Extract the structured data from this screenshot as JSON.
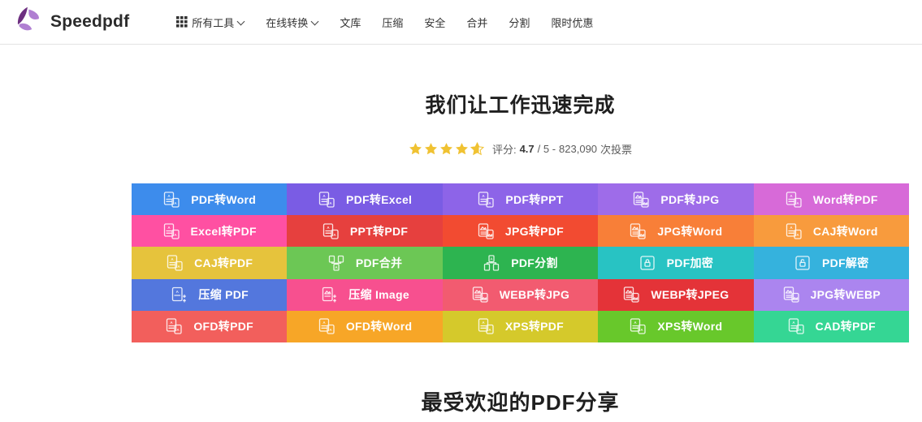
{
  "brand": {
    "name": "Speedpdf"
  },
  "nav": {
    "items": [
      {
        "label": "所有工具",
        "grid_icon": true,
        "chevron": true
      },
      {
        "label": "在线转换",
        "grid_icon": false,
        "chevron": true
      },
      {
        "label": "文库",
        "grid_icon": false,
        "chevron": false
      },
      {
        "label": "压缩",
        "grid_icon": false,
        "chevron": false
      },
      {
        "label": "安全",
        "grid_icon": false,
        "chevron": false
      },
      {
        "label": "合并",
        "grid_icon": false,
        "chevron": false
      },
      {
        "label": "分割",
        "grid_icon": false,
        "chevron": false
      },
      {
        "label": "限时优惠",
        "grid_icon": false,
        "chevron": false
      }
    ]
  },
  "hero": {
    "title": "我们让工作迅速完成",
    "rating": {
      "stars_full": 4,
      "partial_fill_percent": 65,
      "star_color": "#f0c232",
      "prefix": "评分:",
      "score": "4.7",
      "mid": "/ 5 -",
      "votes": "823,090",
      "suffix": "次投票"
    }
  },
  "tools": {
    "cells": [
      {
        "label": "PDF转Word",
        "color": "#3d8cec",
        "icon": "docs-convert-icon"
      },
      {
        "label": "PDF转Excel",
        "color": "#7a5ce4",
        "icon": "docs-convert-icon"
      },
      {
        "label": "PDF转PPT",
        "color": "#8d64e8",
        "icon": "docs-convert-icon"
      },
      {
        "label": "PDF转JPG",
        "color": "#9e6ce9",
        "icon": "docs-image-convert-icon"
      },
      {
        "label": "Word转PDF",
        "color": "#d76ad8",
        "icon": "docs-convert-icon"
      },
      {
        "label": "Excel转PDF",
        "color": "#ff50a2",
        "icon": "docs-convert-icon"
      },
      {
        "label": "PPT转PDF",
        "color": "#e6403e",
        "icon": "docs-convert-icon"
      },
      {
        "label": "JPG转PDF",
        "color": "#f24b31",
        "icon": "docs-image-convert-icon"
      },
      {
        "label": "JPG转Word",
        "color": "#f87f38",
        "icon": "docs-image-convert-icon"
      },
      {
        "label": "CAJ转Word",
        "color": "#f89b3d",
        "icon": "docs-convert-icon"
      },
      {
        "label": "CAJ转PDF",
        "color": "#e6c33c",
        "icon": "docs-convert-icon"
      },
      {
        "label": "PDF合并",
        "color": "#6cc755",
        "icon": "merge-icon"
      },
      {
        "label": "PDF分割",
        "color": "#2db450",
        "icon": "split-icon"
      },
      {
        "label": "PDF加密",
        "color": "#28c3c3",
        "icon": "lock-icon"
      },
      {
        "label": "PDF解密",
        "color": "#35b2dd",
        "icon": "unlock-icon"
      },
      {
        "label": "压缩 PDF",
        "color": "#5377dd",
        "icon": "compress-doc-icon"
      },
      {
        "label": "压缩 Image",
        "color": "#f7508f",
        "icon": "compress-image-icon"
      },
      {
        "label": "WEBP转JPG",
        "color": "#f25b70",
        "icon": "docs-image-convert-icon"
      },
      {
        "label": "WEBP转JPEG",
        "color": "#e43338",
        "icon": "docs-image-convert-icon"
      },
      {
        "label": "JPG转WEBP",
        "color": "#ab85ef",
        "icon": "docs-image-convert-icon"
      },
      {
        "label": "OFD转PDF",
        "color": "#f25f5c",
        "icon": "docs-convert-icon"
      },
      {
        "label": "OFD转Word",
        "color": "#f7a627",
        "icon": "docs-convert-icon"
      },
      {
        "label": "XPS转PDF",
        "color": "#d5c92b",
        "icon": "docs-convert-icon"
      },
      {
        "label": "XPS转Word",
        "color": "#68c82b",
        "icon": "docs-convert-icon"
      },
      {
        "label": "CAD转PDF",
        "color": "#35d694",
        "icon": "docs-convert-icon"
      }
    ]
  },
  "sections": {
    "popular_title": "最受欢迎的PDF分享"
  }
}
